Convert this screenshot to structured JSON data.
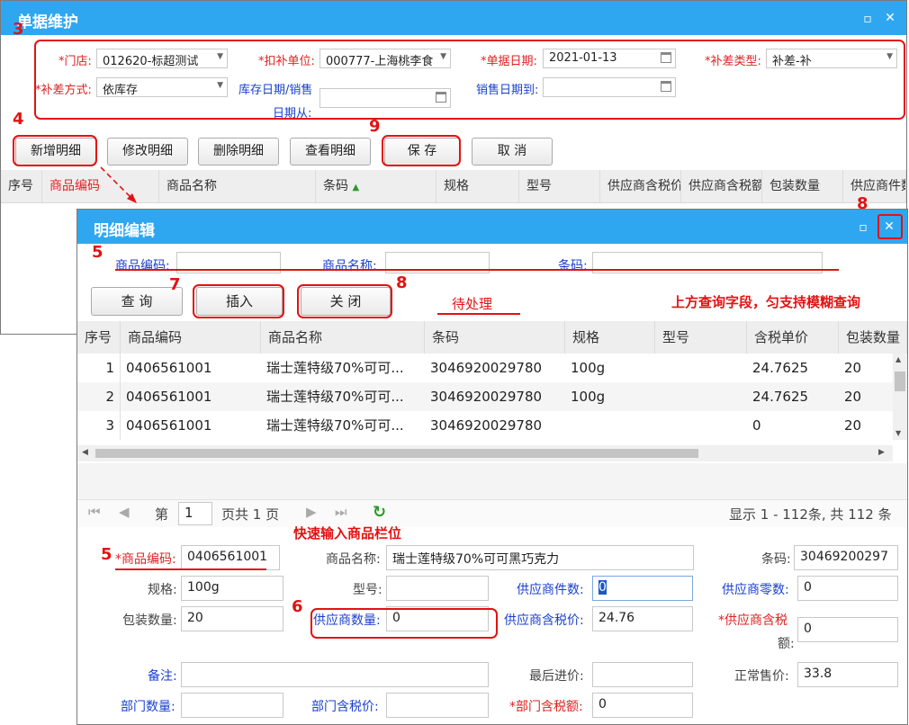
{
  "main_window": {
    "title": "单据维护",
    "labels": {
      "store": "*门店:",
      "deduct_unit": "*扣补单位:",
      "doc_date": "*单据日期:",
      "diff_type": "*补差类型:",
      "diff_method": "*补差方式:",
      "stock_date_from_line1": "库存日期/销售",
      "stock_date_from_line2": "日期从:",
      "sale_date_to": "销售日期到:"
    },
    "values": {
      "store": "012620-标超测试",
      "deduct_unit": "000777-上海桃李食",
      "doc_date": "2021-01-13",
      "diff_type": "补差-补",
      "diff_method": "依库存",
      "stock_date_from": "",
      "sale_date_to": ""
    },
    "buttons": {
      "add": "新增明细",
      "edit": "修改明细",
      "delete": "删除明细",
      "view": "查看明细",
      "save": "保 存",
      "cancel": "取 消"
    },
    "columns": [
      "序号",
      "商品编码",
      "商品名称",
      "条码",
      "规格",
      "型号",
      "供应商含税价",
      "供应商含税额",
      "包装数量",
      "供应商件数"
    ],
    "sort_indicator": "▲"
  },
  "detail_window": {
    "title": "明细编辑",
    "search_labels": {
      "code": "商品编码:",
      "name": "商品名称:",
      "barcode": "条码:"
    },
    "search_values": {
      "code": "",
      "name": "",
      "barcode": ""
    },
    "buttons": {
      "query": "查 询",
      "insert": "插入",
      "close": "关 闭"
    },
    "pending_label": "待处理",
    "columns": [
      "序号",
      "商品编码",
      "商品名称",
      "条码",
      "规格",
      "型号",
      "含税单价",
      "包装数量"
    ],
    "rows": [
      {
        "seq": "1",
        "code": "0406561001",
        "name": "瑞士莲特级70%可可...",
        "barcode": "3046920029780",
        "spec": "100g",
        "model": "",
        "price": "24.7625",
        "pack": "20"
      },
      {
        "seq": "2",
        "code": "0406561001",
        "name": "瑞士莲特级70%可可...",
        "barcode": "3046920029780",
        "spec": "100g",
        "model": "",
        "price": "24.7625",
        "pack": "20"
      },
      {
        "seq": "3",
        "code": "0406561001",
        "name": "瑞士莲特级70%可可...",
        "barcode": "3046920029780",
        "spec": "",
        "model": "",
        "price": "0",
        "pack": "20"
      }
    ],
    "pager": {
      "page_prefix": "第",
      "page": "1",
      "page_suffix": "页共 1 页",
      "summary": "显示 1 - 112条, 共 112 条"
    },
    "form_labels": {
      "code": "*商品编码:",
      "name": "商品名称:",
      "barcode": "条码:",
      "spec": "规格:",
      "model": "型号:",
      "supplier_pieces": "供应商件数:",
      "supplier_loose": "供应商零数:",
      "pack_qty": "包装数量:",
      "supplier_qty": "供应商数量:",
      "supplier_tax_price": "供应商含税价:",
      "supplier_tax_amount_line1": "*供应商含税",
      "supplier_tax_amount_line2": "额:",
      "remark": "备注:",
      "last_price": "最后进价:",
      "normal_price": "正常售价:",
      "dept_qty": "部门数量:",
      "dept_tax_price": "部门含税价:",
      "dept_tax_amount": "*部门含税额:"
    },
    "form_values": {
      "code": "0406561001",
      "name": "瑞士莲特级70%可可黑巧克力",
      "barcode": "30469200297",
      "spec": "100g",
      "model": "",
      "supplier_pieces": "0",
      "supplier_loose": "0",
      "pack_qty": "20",
      "supplier_qty": "0",
      "supplier_tax_price": "24.76",
      "supplier_tax_amount": "0",
      "remark": "",
      "last_price": "",
      "normal_price": "33.8",
      "dept_qty": "",
      "dept_tax_price": "",
      "dept_tax_amount": "0"
    }
  },
  "annotations": {
    "n3": "3",
    "n4": "4",
    "n5a": "5",
    "n5b": "5",
    "n6": "6",
    "n7": "7",
    "n8a": "8",
    "n8b": "8",
    "n9": "9",
    "search_note": "上方查询字段，匀支持模糊查询",
    "quick_input_note": "快速输入商品栏位"
  },
  "icons": {
    "maximize": "maximize-icon",
    "close": "close-icon",
    "calendar": "calendar-icon",
    "dropdown": "chevron-down-icon",
    "refresh": "refresh-icon"
  },
  "colors": {
    "titlebar": "#2fa7f0",
    "annotation": "#e21212",
    "required_label": "#d22222",
    "link_label": "#1a3fd0"
  }
}
